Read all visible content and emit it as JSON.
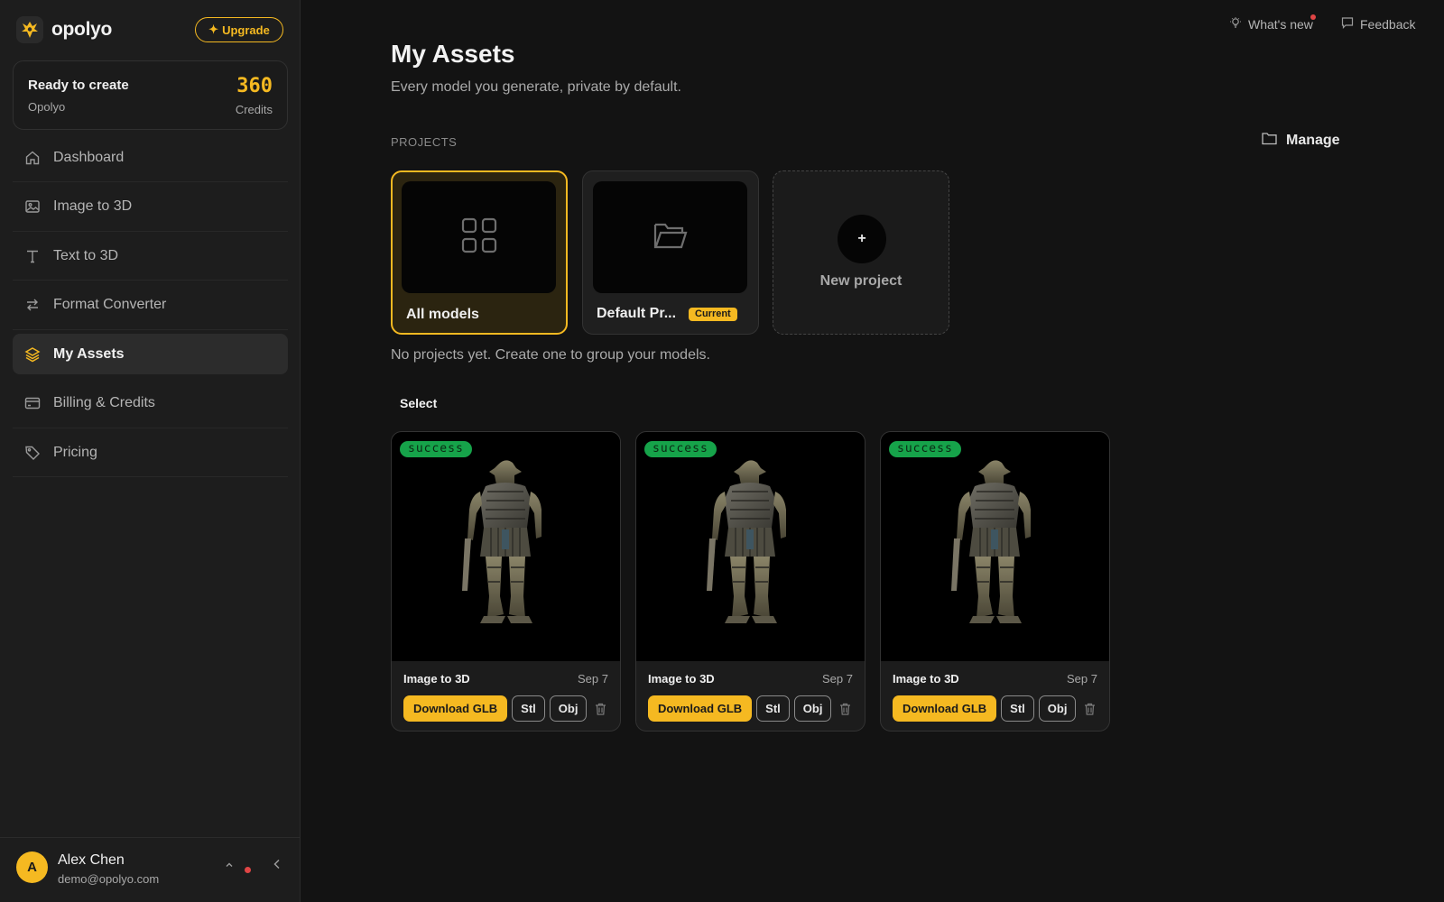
{
  "brand": {
    "name": "opolyo"
  },
  "upgrade": {
    "label": "Upgrade"
  },
  "credits_card": {
    "title": "Ready to create",
    "subtitle": "Opolyo",
    "credits": "360",
    "credits_label": "Credits"
  },
  "nav": [
    {
      "label": "Dashboard",
      "icon": "home-icon",
      "active": false
    },
    {
      "label": "Image to 3D",
      "icon": "image-icon",
      "active": false
    },
    {
      "label": "Text to 3D",
      "icon": "text-icon",
      "active": false
    },
    {
      "label": "Format Converter",
      "icon": "arrows-swap-icon",
      "active": false
    },
    {
      "label": "My Assets",
      "icon": "layers-icon",
      "active": true
    },
    {
      "label": "Billing & Credits",
      "icon": "credit-card-icon",
      "active": false
    },
    {
      "label": "Pricing",
      "icon": "tag-icon",
      "active": false
    }
  ],
  "user": {
    "initial": "A",
    "name": "Alex Chen",
    "email": "demo@opolyo.com"
  },
  "topbar": {
    "whats_new": "What's new",
    "feedback": "Feedback"
  },
  "page": {
    "title": "My Assets",
    "subtitle": "Every model you generate, private by default.",
    "projects_label": "PROJECTS",
    "manage_label": "Manage",
    "empty_message": "No projects yet. Create one to group your models.",
    "select_label": "Select"
  },
  "projects": [
    {
      "name": "All models",
      "icon": "grid-icon",
      "selected": true
    },
    {
      "name": "Default Pr...",
      "icon": "folder-open-icon",
      "badge": "Current",
      "selected": false
    }
  ],
  "new_project": {
    "plus": "+",
    "label": "New project"
  },
  "assets": [
    {
      "status": "success",
      "type": "Image to 3D",
      "date": "Sep 7",
      "glb_label": "Download GLB",
      "stl_label": "Stl",
      "obj_label": "Obj"
    },
    {
      "status": "success",
      "type": "Image to 3D",
      "date": "Sep 7",
      "glb_label": "Download GLB",
      "stl_label": "Stl",
      "obj_label": "Obj"
    },
    {
      "status": "success",
      "type": "Image to 3D",
      "date": "Sep 7",
      "glb_label": "Download GLB",
      "stl_label": "Stl",
      "obj_label": "Obj"
    }
  ],
  "colors": {
    "accent": "#f5b921",
    "success": "#16a34a",
    "background": "#131313",
    "sidebar": "#1d1d1d",
    "alert": "#e04545"
  }
}
